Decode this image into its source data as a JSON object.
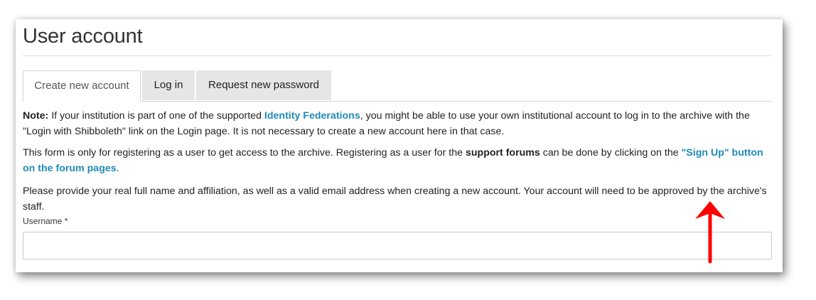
{
  "page": {
    "title": "User account"
  },
  "tabs": [
    {
      "label": "Create new account",
      "active": true
    },
    {
      "label": "Log in",
      "active": false
    },
    {
      "label": "Request new password",
      "active": false
    }
  ],
  "notice": {
    "note_label": "Note:",
    "text_1": " If your institution is part of one of the supported ",
    "link_identity": "Identity Federations",
    "text_2": ", you might be able to use your own institutional account to log in to the archive with the \"Login with Shibboleth\" link on the Login page. It is not necessary to create a new account here in that case."
  },
  "info": {
    "text_1": "This form is only for registering as a user to get access to the archive. Registering as a user for the ",
    "bold_support": "support forums",
    "text_2": " can be done by clicking on the ",
    "link_signup": "\"Sign Up\" button on the forum pages",
    "text_3": "."
  },
  "instructions": {
    "text": "Please provide your real full name and affiliation, as well as a valid email address when creating a new account. Your account will need to be approved by the archive's staff."
  },
  "form": {
    "username_label": "Username *",
    "username_value": ""
  },
  "colors": {
    "link": "#1f8bb5",
    "annotation_arrow": "#ff0000",
    "tab_inactive_bg": "#e6e6e6"
  },
  "icons": {
    "annotation": "red-arrow-up-icon"
  }
}
